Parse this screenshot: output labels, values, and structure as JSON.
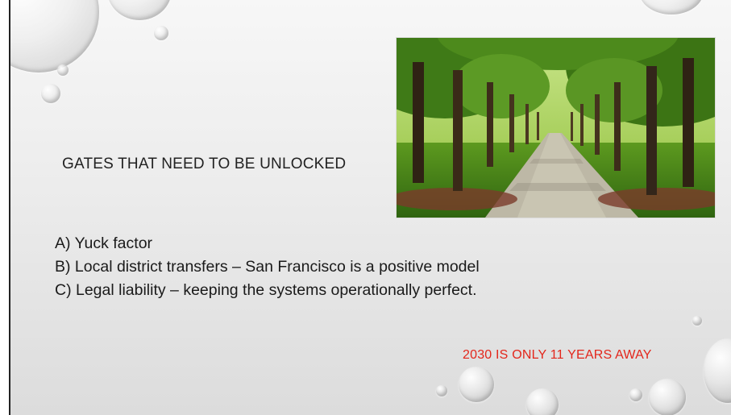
{
  "slide": {
    "heading": "GATES THAT NEED TO BE UNLOCKED",
    "items": [
      "A) Yuck factor",
      "B) Local district transfers – San Francisco is a positive model",
      "C) Legal liability – keeping the systems operationally perfect."
    ],
    "callout": "2030 IS ONLY 11 YEARS AWAY",
    "callout_color": "#e3261b",
    "photo_subject": "tree-lined park path"
  }
}
